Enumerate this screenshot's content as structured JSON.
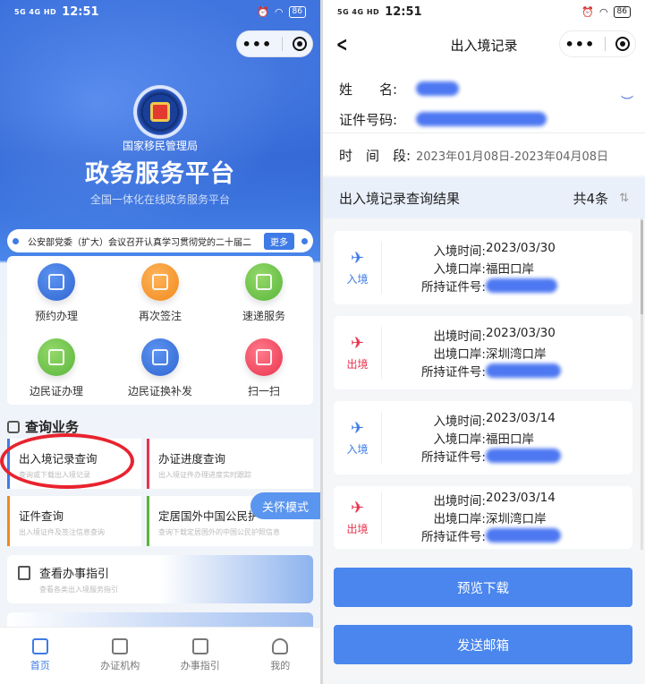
{
  "left": {
    "status": {
      "net": "5G 4G HD",
      "time": "12:51",
      "battery": "86"
    },
    "header": {
      "agency": "国家移民管理局",
      "platform_title": "政务服务平台",
      "slogan": "全国一体化在线政务服务平台"
    },
    "news": {
      "text": "公安部党委（扩大）会议召开认真学习贯彻党的二十届二",
      "more": "更多"
    },
    "services": [
      {
        "label": "预约办理",
        "color": "blue",
        "icon": "calendar-icon"
      },
      {
        "label": "再次签注",
        "color": "orange",
        "icon": "document-stamp-icon"
      },
      {
        "label": "速递服务",
        "color": "green",
        "icon": "truck-icon"
      },
      {
        "label": "边民证办理",
        "color": "green",
        "icon": "id-card-icon"
      },
      {
        "label": "边民证换补发",
        "color": "blue",
        "icon": "card-reissue-icon"
      },
      {
        "label": "扫一扫",
        "color": "red",
        "icon": "scan-icon"
      }
    ],
    "query_section": {
      "title": "查询业务",
      "cards": [
        {
          "title": "出入境记录查询",
          "sub": "查询或下载出入境记录"
        },
        {
          "title": "办证进度查询",
          "sub": "出入境证件办理进度实时跟踪"
        },
        {
          "title": "证件查询",
          "sub": "出入境证件及签注信息查询"
        },
        {
          "title": "定居国外中国公民护",
          "sub": "查询下载定居国外的中国公民护照信息"
        }
      ]
    },
    "care_mode": "关怀模式",
    "guide": {
      "title": "查看办事指引",
      "sub": "查看各类出入境服务指引"
    },
    "tabs": [
      {
        "label": "首页",
        "icon": "home-icon"
      },
      {
        "label": "办证机构",
        "icon": "building-icon"
      },
      {
        "label": "办事指引",
        "icon": "guide-doc-icon"
      },
      {
        "label": "我的",
        "icon": "person-icon"
      }
    ],
    "colors": {
      "accent": "#3e7be6",
      "highlight_circle": "#e8232e"
    }
  },
  "right": {
    "status": {
      "net": "5G 4G HD",
      "time": "12:51",
      "battery": "86"
    },
    "nav_title": "出入境记录",
    "info": {
      "name_label": "姓　　名:",
      "id_label": "证件号码:",
      "period_label": "时　间　段:",
      "period_value": "2023年01月08日-2023年04月08日"
    },
    "result": {
      "title": "出入境记录查询结果",
      "count": "共4条"
    },
    "records": [
      {
        "dir": "入境",
        "type": "in",
        "time_label": "入境时间:",
        "time": "2023/03/30",
        "port_label": "入境口岸:",
        "port": "福田口岸",
        "doc_label": "所持证件号:"
      },
      {
        "dir": "出境",
        "type": "out",
        "time_label": "出境时间:",
        "time": "2023/03/30",
        "port_label": "出境口岸:",
        "port": "深圳湾口岸",
        "doc_label": "所持证件号:"
      },
      {
        "dir": "入境",
        "type": "in",
        "time_label": "入境时间:",
        "time": "2023/03/14",
        "port_label": "入境口岸:",
        "port": "福田口岸",
        "doc_label": "所持证件号:"
      },
      {
        "dir": "出境",
        "type": "out",
        "time_label": "出境时间:",
        "time": "2023/03/14",
        "port_label": "出境口岸:",
        "port": "深圳湾口岸",
        "doc_label": "所持证件号:"
      }
    ],
    "buttons": {
      "preview": "预览下载",
      "email": "发送邮箱"
    }
  }
}
